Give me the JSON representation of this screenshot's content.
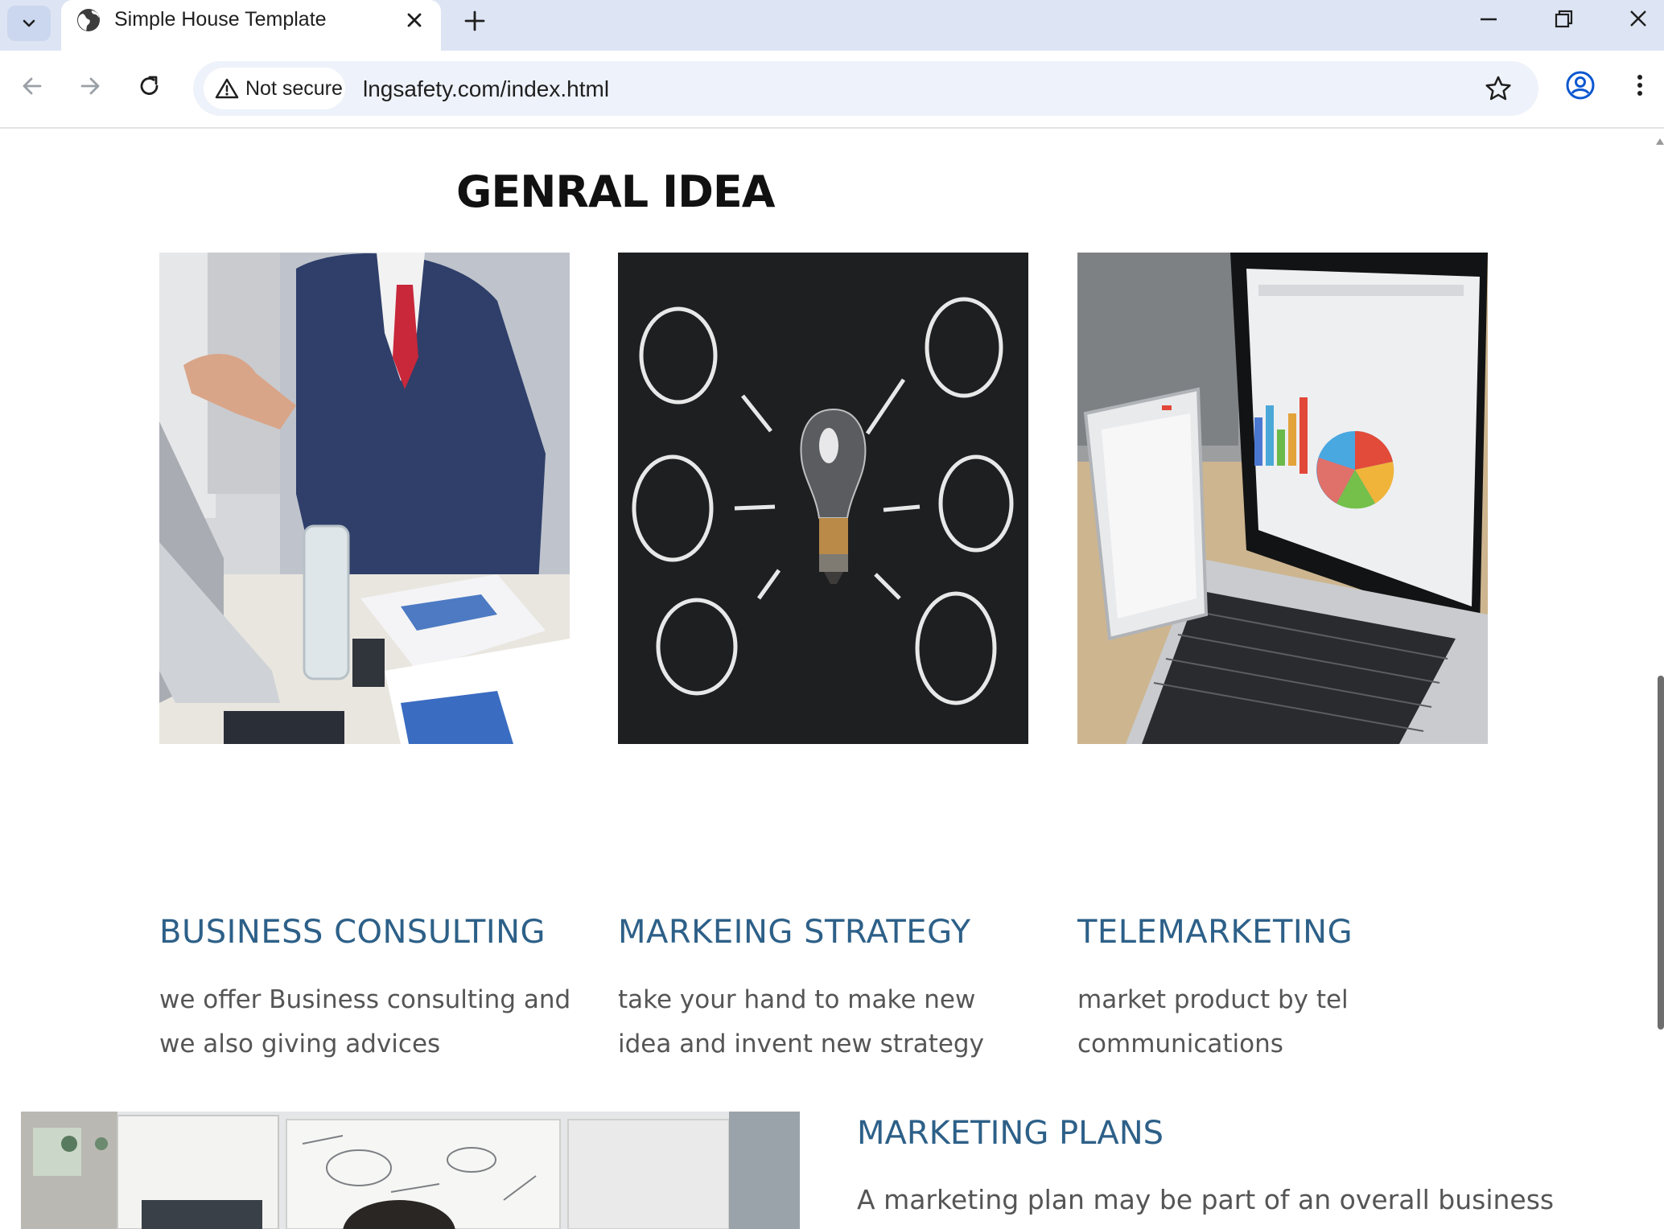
{
  "browser": {
    "tab_title": "Simple House Template",
    "security_label": "Not secure",
    "url": "lngsafety.com/index.html"
  },
  "page": {
    "heading": "GENRAL IDEA",
    "cards": [
      {
        "title": "BUSINESS CONSULTING",
        "description": "we offer Business consulting and we also giving advices",
        "image": "business-meeting-photo"
      },
      {
        "title": "MARKEING STRATEGY",
        "description": "take your hand to make new idea and invent new strategy",
        "image": "lightbulb-chalkboard-photo"
      },
      {
        "title": "TELEMARKETING",
        "description": "market product by tel communications",
        "image": "laptop-charts-photo"
      }
    ],
    "plans": {
      "title": "MARKETING PLANS",
      "text": "A marketing plan may be part of an overall business"
    }
  },
  "colors": {
    "accent_title": "#2d6088",
    "body_text": "#555555",
    "tabstrip": "#dde5f4"
  }
}
